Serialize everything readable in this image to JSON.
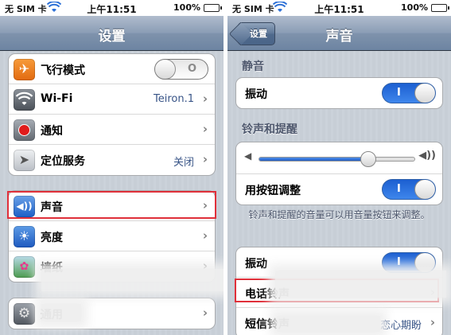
{
  "left": {
    "status": {
      "carrier": "无 SIM 卡",
      "time": "上午11:51",
      "battery": "100%"
    },
    "nav": {
      "title": "设置"
    },
    "rows": [
      {
        "label": "飞行模式",
        "icon": "airplane-icon",
        "switch": "off"
      },
      {
        "label": "Wi-Fi",
        "value": "Teiron.1",
        "icon": "wifi-icon"
      },
      {
        "label": "通知",
        "icon": "notification-icon"
      },
      {
        "label": "定位服务",
        "value": "关闭",
        "icon": "location-icon"
      },
      {
        "label": "声音",
        "icon": "sound-icon"
      },
      {
        "label": "亮度",
        "icon": "brightness-icon"
      },
      {
        "label": "墙纸",
        "icon": "wallpaper-icon"
      },
      {
        "label": "通用",
        "icon": "general-icon"
      }
    ]
  },
  "right": {
    "status": {
      "carrier": "无 SIM 卡",
      "time": "上午11:51",
      "battery": "100%"
    },
    "nav": {
      "title": "声音",
      "back": "设置"
    },
    "silent": {
      "header": "静音",
      "vibrate_label": "振动",
      "vibrate": "on"
    },
    "ringer": {
      "header": "铃声和提醒",
      "volume_level": 0.7,
      "adjust_label": "用按钮调整",
      "adjust": "on",
      "note": "铃声和提醒的音量可以用音量按钮来调整。"
    },
    "ring_rows": [
      {
        "label": "振动",
        "switch": "on"
      },
      {
        "label": "电话铃声",
        "value": ""
      },
      {
        "label": "短信铃声",
        "value": "恋心期盼"
      }
    ]
  },
  "colors": {
    "highlight": "#e0303a",
    "switch_on": "#2f78e0",
    "value_text": "#385487",
    "section_header": "#4c566c"
  }
}
